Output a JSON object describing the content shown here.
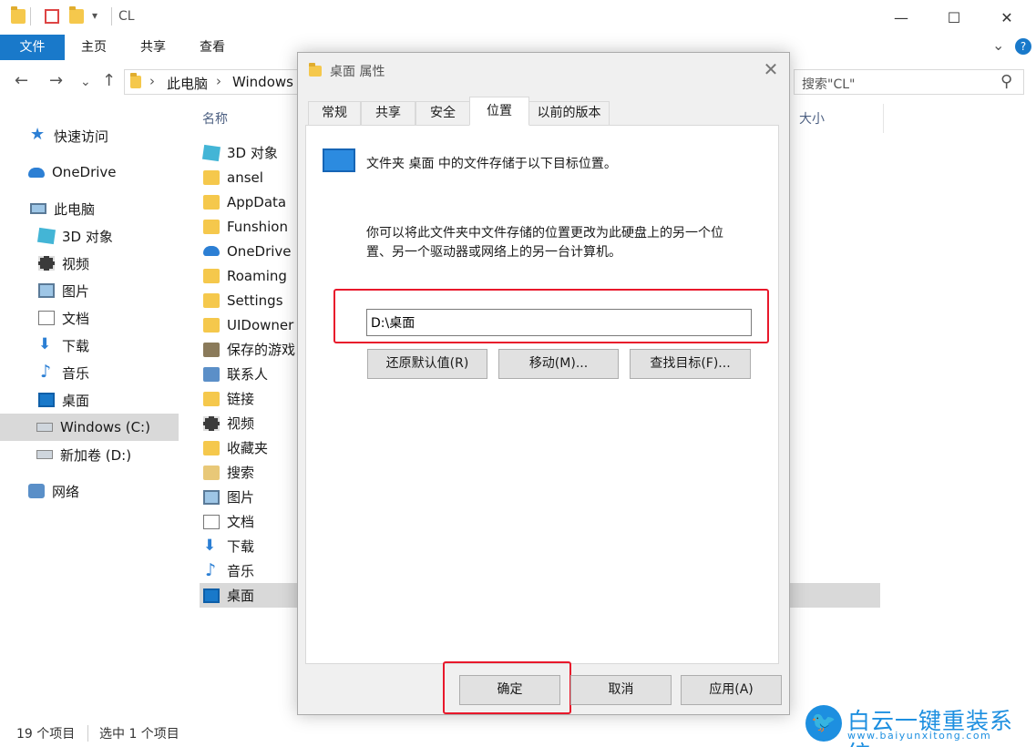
{
  "window": {
    "title": "CL",
    "minimize": "—",
    "maximize": "☐",
    "close": "✕"
  },
  "ribbon": {
    "tabs": [
      "文件",
      "主页",
      "共享",
      "查看"
    ],
    "chevron": "⌄",
    "help": "?"
  },
  "address": {
    "back": "←",
    "forward": "→",
    "recent": "⌄",
    "up": "↑",
    "separator": "›",
    "crumbs": [
      "此电脑",
      "Windows"
    ],
    "search_placeholder": "搜索\"CL\"",
    "search_icon": "⚲"
  },
  "nav_pane": {
    "items": [
      {
        "label": "快速访问",
        "icon": "star-icon"
      },
      {
        "label": "OneDrive",
        "icon": "cloud-icon"
      },
      {
        "label": "此电脑",
        "icon": "pc-icon"
      },
      {
        "label": "3D 对象",
        "icon": "cube-icon"
      },
      {
        "label": "视频",
        "icon": "film-icon"
      },
      {
        "label": "图片",
        "icon": "picture-icon"
      },
      {
        "label": "文档",
        "icon": "document-icon"
      },
      {
        "label": "下载",
        "icon": "download-icon"
      },
      {
        "label": "音乐",
        "icon": "music-icon"
      },
      {
        "label": "桌面",
        "icon": "desktop-icon"
      },
      {
        "label": "Windows (C:)",
        "icon": "drive-icon",
        "selected": true
      },
      {
        "label": "新加卷 (D:)",
        "icon": "drive-icon"
      },
      {
        "label": "网络",
        "icon": "network-icon"
      }
    ]
  },
  "file_list": {
    "columns": [
      "名称",
      "大小"
    ],
    "rows": [
      {
        "name": "3D 对象",
        "icon": "cube-icon"
      },
      {
        "name": "ansel",
        "icon": "folder-icon"
      },
      {
        "name": "AppData",
        "icon": "folder-icon"
      },
      {
        "name": "Funshion",
        "icon": "folder-icon"
      },
      {
        "name": "OneDrive",
        "icon": "cloud-icon"
      },
      {
        "name": "Roaming",
        "icon": "folder-icon"
      },
      {
        "name": "Settings",
        "icon": "folder-icon"
      },
      {
        "name": "UIDowner",
        "icon": "folder-icon"
      },
      {
        "name": "保存的游戏",
        "icon": "saved-games-icon"
      },
      {
        "name": "联系人",
        "icon": "contacts-icon"
      },
      {
        "name": "链接",
        "icon": "links-icon"
      },
      {
        "name": "视频",
        "icon": "film-icon"
      },
      {
        "name": "收藏夹",
        "icon": "favorites-icon"
      },
      {
        "name": "搜索",
        "icon": "search-folder-icon"
      },
      {
        "name": "图片",
        "icon": "picture-icon"
      },
      {
        "name": "文档",
        "icon": "document-icon"
      },
      {
        "name": "下载",
        "icon": "download-icon"
      },
      {
        "name": "音乐",
        "icon": "music-icon"
      },
      {
        "name": "桌面",
        "icon": "desktop-icon",
        "selected": true
      }
    ]
  },
  "status": {
    "count": "19 个项目",
    "selection": "选中 1 个项目"
  },
  "dialog": {
    "title": "桌面 属性",
    "close": "✕",
    "tabs": [
      "常规",
      "共享",
      "安全",
      "位置",
      "以前的版本"
    ],
    "active_tab": "位置",
    "heading": "文件夹 桌面 中的文件存储于以下目标位置。",
    "description_line1": "你可以将此文件夹中文件存储的位置更改为此硬盘上的另一个位",
    "description_line2": "置、另一个驱动器或网络上的另一台计算机。",
    "path_value": "D:\\桌面",
    "restore_label": "还原默认值(R)",
    "move_label": "移动(M)...",
    "find_label": "查找目标(F)...",
    "ok_label": "确定",
    "cancel_label": "取消",
    "apply_label": "应用(A)"
  },
  "watermark": {
    "logo_glyph": "🐦",
    "name": "白云一键重装系统",
    "url": "www.baiyunxitong.com"
  },
  "colors": {
    "accent": "#1979ca",
    "highlight_box": "#e8182b",
    "watermark": "#1d8fe0"
  }
}
